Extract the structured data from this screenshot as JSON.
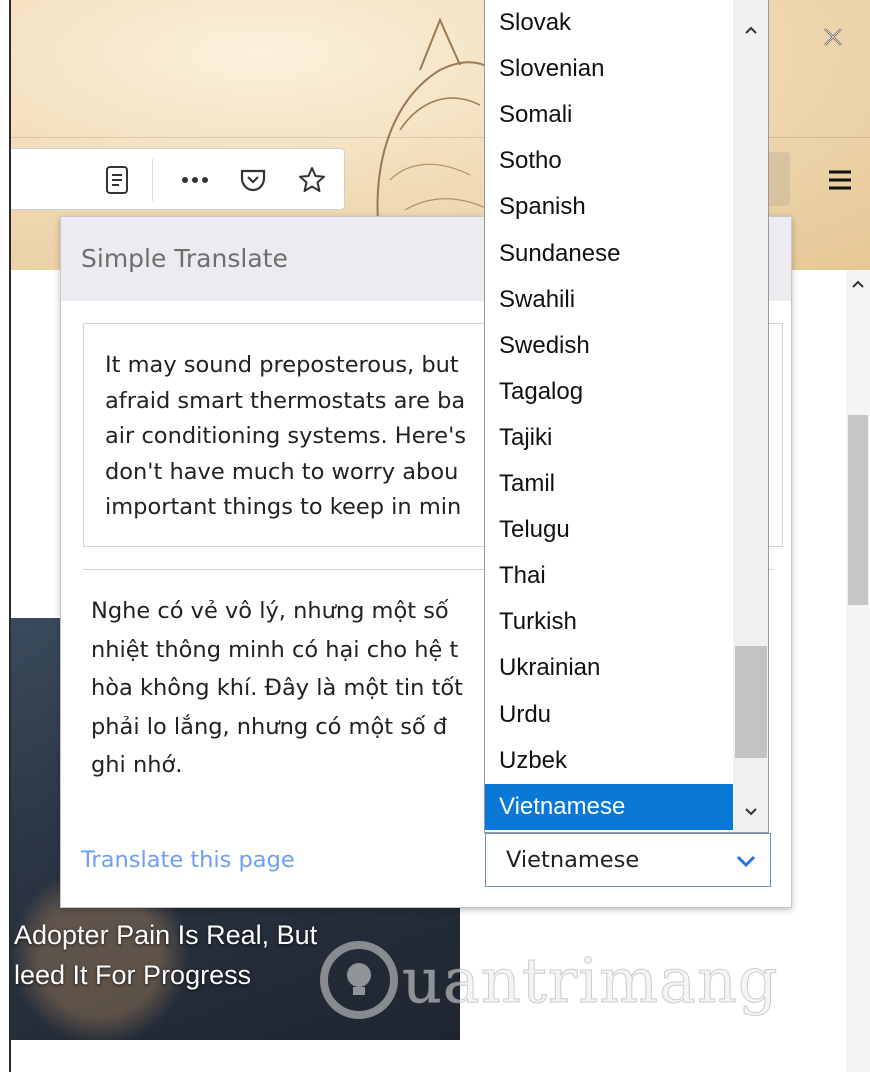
{
  "browser": {
    "toolbar_icons": [
      "reader-view-icon",
      "more-actions-icon",
      "pocket-icon",
      "bookmark-star-icon",
      "hamburger-menu-icon",
      "close-icon"
    ]
  },
  "popup": {
    "title": "Simple Translate",
    "source_text": "It may sound preposterous, but\nafraid smart thermostats are ba\nair conditioning systems. Here's\ndon't have much to worry abou\nimportant things to keep in min",
    "result_text": "Nghe có vẻ vô lý, nhưng một số\nnhiệt thông minh có hại cho hệ t\nhòa không khí. Đây là một tin tốt\nphải lo lắng, nhưng có một số đ\nghi nhớ.",
    "translate_page_link": "Translate this page",
    "target_language": "Vietnamese"
  },
  "dropdown": {
    "options": [
      "Slovak",
      "Slovenian",
      "Somali",
      "Sotho",
      "Spanish",
      "Sundanese",
      "Swahili",
      "Swedish",
      "Tagalog",
      "Tajiki",
      "Tamil",
      "Telugu",
      "Thai",
      "Turkish",
      "Ukrainian",
      "Urdu",
      "Uzbek",
      "Vietnamese"
    ],
    "selected": "Vietnamese"
  },
  "article": {
    "title_line1": "Adopter Pain Is Real, But",
    "title_line2": "leed It For Progress"
  },
  "watermark": {
    "text": "uantrimang"
  },
  "colors": {
    "selected_option": "#0a78d7",
    "link": "#6e9ff2",
    "popup_header": "#ececf0"
  }
}
